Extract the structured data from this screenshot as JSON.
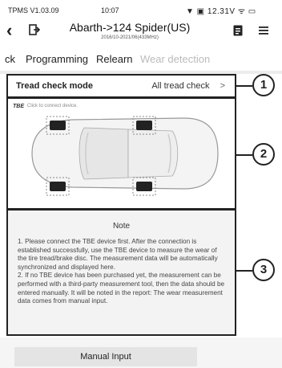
{
  "status_bar": {
    "version": "TPMS V1.03.09",
    "time": "10:07",
    "indicators": "12.31V"
  },
  "header": {
    "title": "Abarth->124 Spider(US)",
    "subtitle": "2016/10-2021/06(433MHz)"
  },
  "tabs": [
    {
      "label": "ck"
    },
    {
      "label": "Programming"
    },
    {
      "label": "Relearn"
    },
    {
      "label": "Wear detection"
    }
  ],
  "tread": {
    "label": "Tread check mode",
    "value": "All tread check",
    "chevron": ">"
  },
  "device": {
    "tag": "TBE",
    "hint": "Click to connect device."
  },
  "note": {
    "title": "Note",
    "body": "1. Please connect the TBE device first. After the connection is established successfully, use the TBE device to measure the wear of the tire tread/brake disc. The measurement data will be automatically synchronized and displayed here.\n 2. If no TBE device has been purchased yet, the measurement can be performed with a third-party measurement tool, then the data should be entered manually. It will be noted in the report: The wear measurement data comes from manual input."
  },
  "buttons": {
    "manual_input": "Manual Input"
  },
  "callouts": [
    "1",
    "2",
    "3"
  ]
}
